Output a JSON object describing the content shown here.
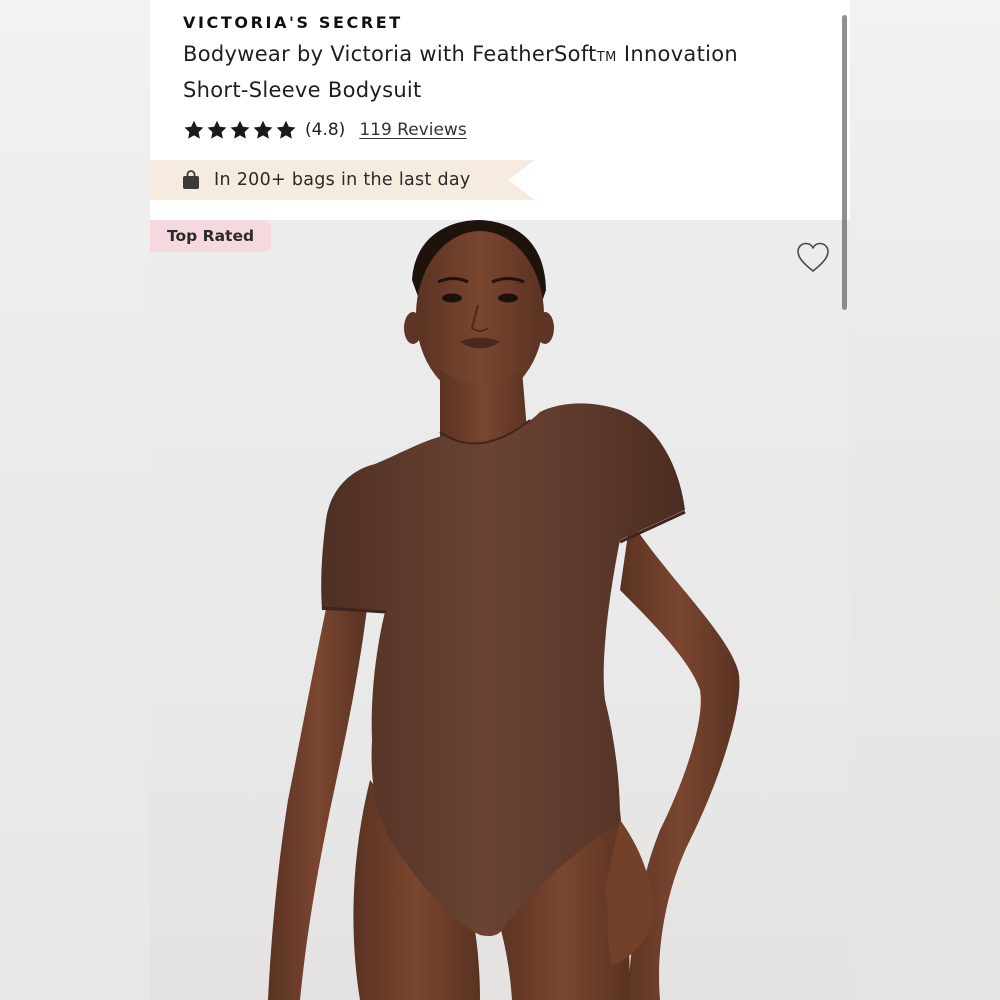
{
  "product": {
    "brand": "VICTORIA'S SECRET",
    "title_main": "Bodywear by Victoria with FeatherSoft",
    "title_tm": "TM",
    "title_after": " Innovation",
    "title_line2": "Short-Sleeve Bodysuit",
    "rating_stars": 5,
    "rating_value": "(4.8)",
    "reviews_label": "119 Reviews",
    "bags_text": "In 200+ bags in the last day",
    "badge": "Top Rated"
  },
  "icons": {
    "star": "star-icon",
    "bag": "shopping-bag-icon",
    "heart": "heart-outline-icon"
  },
  "colors": {
    "banner_bg": "#f6ebdf",
    "badge_bg": "#f6d9df",
    "bodysuit": "#5e3a2c",
    "skin": "#6a3d2a"
  }
}
